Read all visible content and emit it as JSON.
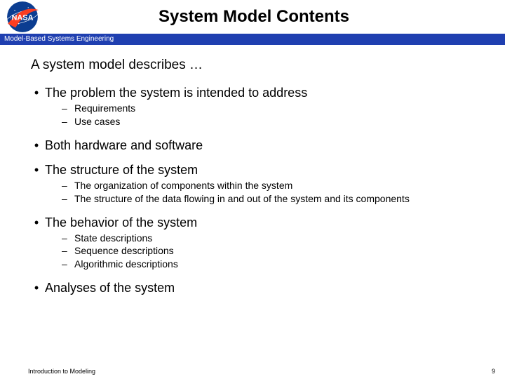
{
  "header": {
    "title": "System Model Contents",
    "bluebar": "Model-Based Systems Engineering"
  },
  "content": {
    "intro": "A system model describes …",
    "bullets": [
      {
        "text": "The problem the system is intended to address",
        "sub": [
          "Requirements",
          "Use cases"
        ]
      },
      {
        "text": "Both hardware and software",
        "sub": []
      },
      {
        "text": "The structure of the system",
        "sub": [
          "The organization of components within the system",
          "The structure of the data flowing in and out of the system and its components"
        ]
      },
      {
        "text": "The behavior of the system",
        "sub": [
          "State descriptions",
          "Sequence descriptions",
          "Algorithmic descriptions"
        ]
      },
      {
        "text": "Analyses of the system",
        "sub": []
      }
    ]
  },
  "footer": {
    "left": "Introduction to Modeling",
    "right": "9"
  }
}
